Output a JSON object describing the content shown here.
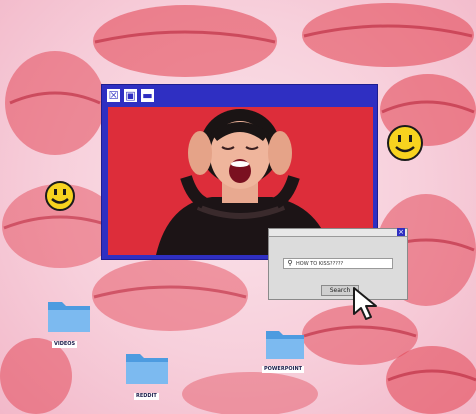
{
  "window": {
    "close_label": "☒",
    "maximize_label": "▣",
    "minimize_label": "▬"
  },
  "dialog": {
    "close_label": "×",
    "search_value": "HOW TO KISS?????",
    "search_button": "Search"
  },
  "desktop": {
    "folders": [
      {
        "label": "VIDEOS"
      },
      {
        "label": "REDDIT"
      },
      {
        "label": "POWERPOINT"
      }
    ]
  },
  "colors": {
    "accent": "#2f2fc2",
    "photo_bg": "#dd2d3a",
    "background": "#f7cfdb",
    "lips": "#e2404f",
    "folder": "#5aa7e8"
  },
  "icons": [
    "close-icon",
    "maximize-icon",
    "minimize-icon",
    "search-icon",
    "folder-icon",
    "smiley-icon",
    "cursor-icon",
    "lips-icon"
  ]
}
